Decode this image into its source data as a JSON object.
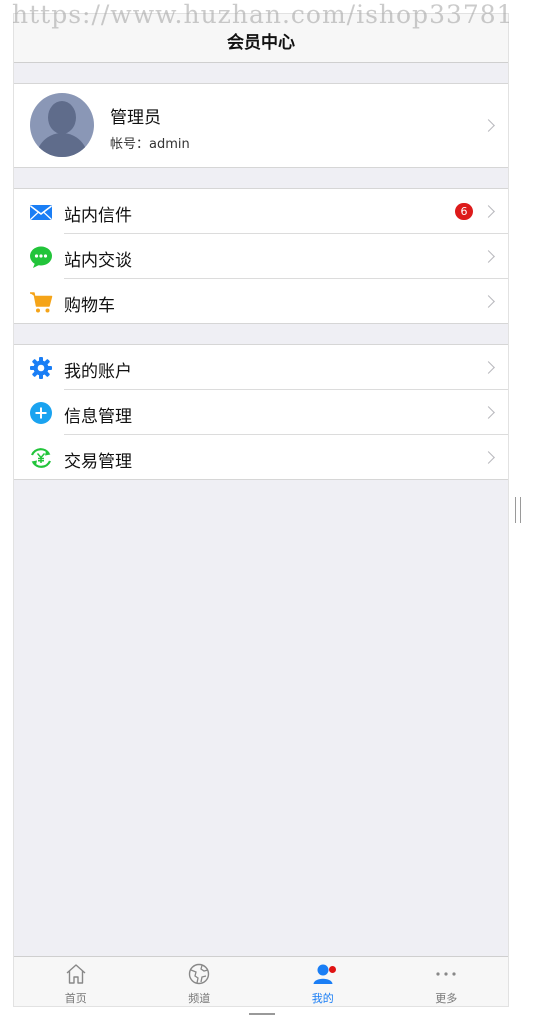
{
  "header": {
    "title": "会员中心",
    "watermark": "https://www.huzhan.com/ishop33781"
  },
  "profile": {
    "name": "管理员",
    "account": "帐号：admin"
  },
  "menu_group_1": [
    {
      "label": "站内信件",
      "icon": "mail-icon",
      "badge": "6"
    },
    {
      "label": "站内交谈",
      "icon": "chat-icon"
    },
    {
      "label": "购物车",
      "icon": "cart-icon"
    }
  ],
  "menu_group_2": [
    {
      "label": "我的账户",
      "icon": "gear-icon"
    },
    {
      "label": "信息管理",
      "icon": "plus-circle-icon"
    },
    {
      "label": "交易管理",
      "icon": "yuan-exchange-icon"
    }
  ],
  "tabbar": [
    {
      "label": "首页",
      "icon": "home-icon"
    },
    {
      "label": "频道",
      "icon": "globe-icon"
    },
    {
      "label": "我的",
      "icon": "user-icon",
      "active": true
    },
    {
      "label": "更多",
      "icon": "more-dots-icon"
    }
  ],
  "colors": {
    "accent": "#1a7ef5",
    "badge": "#dd1b1b",
    "chat": "#22c43a",
    "cart": "#f5a418",
    "background": "#efeff4"
  }
}
